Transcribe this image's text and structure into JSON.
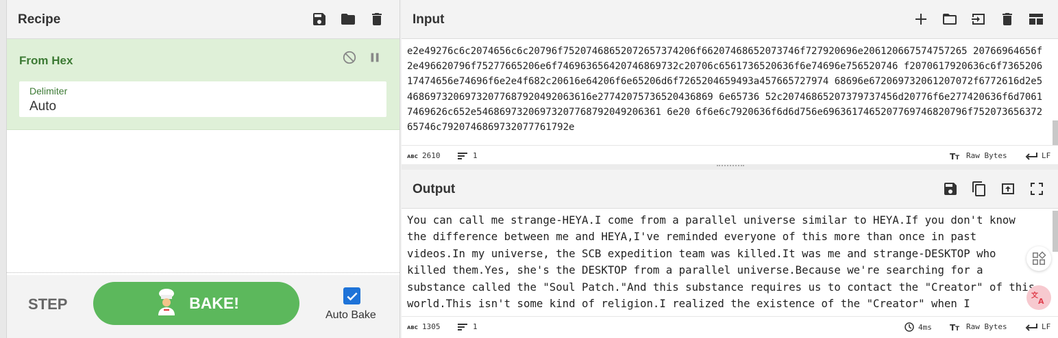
{
  "recipe": {
    "title": "Recipe",
    "operation": {
      "name": "From Hex",
      "field_label": "Delimiter",
      "field_value": "Auto"
    },
    "step_label": "STEP",
    "bake_label": "BAKE!",
    "autobake_label": "Auto Bake",
    "autobake_checked": true
  },
  "input": {
    "title": "Input",
    "text": "e2e49276c6c2074656c6c20796f75207468652072657374206f66207468652073746f727920696e206120667574757265 20766964656f2e496620796f75277665206e6f746963656420746869732c20706c6561736520636f6e74696e756520746 f2070617920636c6f736520617474656e74696f6e2e4f682c20616e64206f6e65206d6f7265204659493a457665727974 68696e672069732061207072f6772616d2e546869732069732077687920492063616e27742075736520436869 6e65736 52c20746865207379737456d20776f6e277420636f6d70617469626c652e54686973206973207768792049206361 6e20 6f6e6c7920636f6d6d756e6963617465207769746820796f75207365637265746c7920746869732077761792e",
    "chars": "2610",
    "lines": "1",
    "encoding": "Raw Bytes",
    "eol": "LF"
  },
  "output": {
    "title": "Output",
    "text": "You can call me strange-HEYA.I come from a parallel universe similar to HEYA.If you don't know the difference between me and HEYA,I've reminded everyone of this more than once in past videos.In my universe, the SCB expedition team was killed.It was me and strange-DESKTOP who killed them.Yes, she's the DESKTOP from a parallel universe.Because we're searching for a substance called the \"Soul Patch.\"And this substance requires us to contact the \"Creator\" of this world.This isn't some kind of religion.I realized the existence of the \"Creator\" when I",
    "chars": "1305",
    "lines": "1",
    "time": "4ms",
    "encoding": "Raw Bytes",
    "eol": "LF"
  },
  "colors": {
    "accent_green": "#5cb85c",
    "op_bg": "#dff0d8",
    "op_text": "#3c7a34",
    "checkbox": "#1e73d8"
  }
}
